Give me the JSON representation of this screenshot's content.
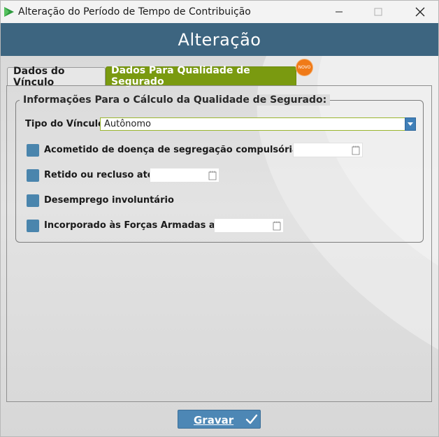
{
  "window": {
    "title": "Alteração do Período de Tempo de Contribuição",
    "controls": {
      "minimize": "minimize-icon",
      "maximize": "maximize-icon",
      "close": "close-icon"
    }
  },
  "header": {
    "title": "Alteração"
  },
  "tabs": [
    {
      "label": "Dados do Vínculo",
      "active": false
    },
    {
      "label": "Dados Para Qualidade de Segurado",
      "active": true,
      "badge": "NOVO"
    }
  ],
  "form": {
    "group_title": "Informações Para o Cálculo da Qualidade de Segurado:",
    "tipo_vinculo": {
      "label": "Tipo do Vínculo:",
      "value": "Autônomo"
    },
    "checks": [
      {
        "label": "Acometido de doença de segregação compulsória até",
        "checked": false,
        "date": ""
      },
      {
        "label": "Retido ou recluso até",
        "checked": false,
        "date": ""
      },
      {
        "label": "Desemprego involuntário",
        "checked": false
      },
      {
        "label": "Incorporado às Forças Armadas até",
        "checked": false,
        "date": ""
      }
    ]
  },
  "actions": {
    "save_label": "Gravar"
  },
  "colors": {
    "header": "#3d6580",
    "active_tab": "#7a9a10",
    "badge": "#f07a18",
    "checkbox": "#4a85ad",
    "button": "#4d87b5"
  }
}
